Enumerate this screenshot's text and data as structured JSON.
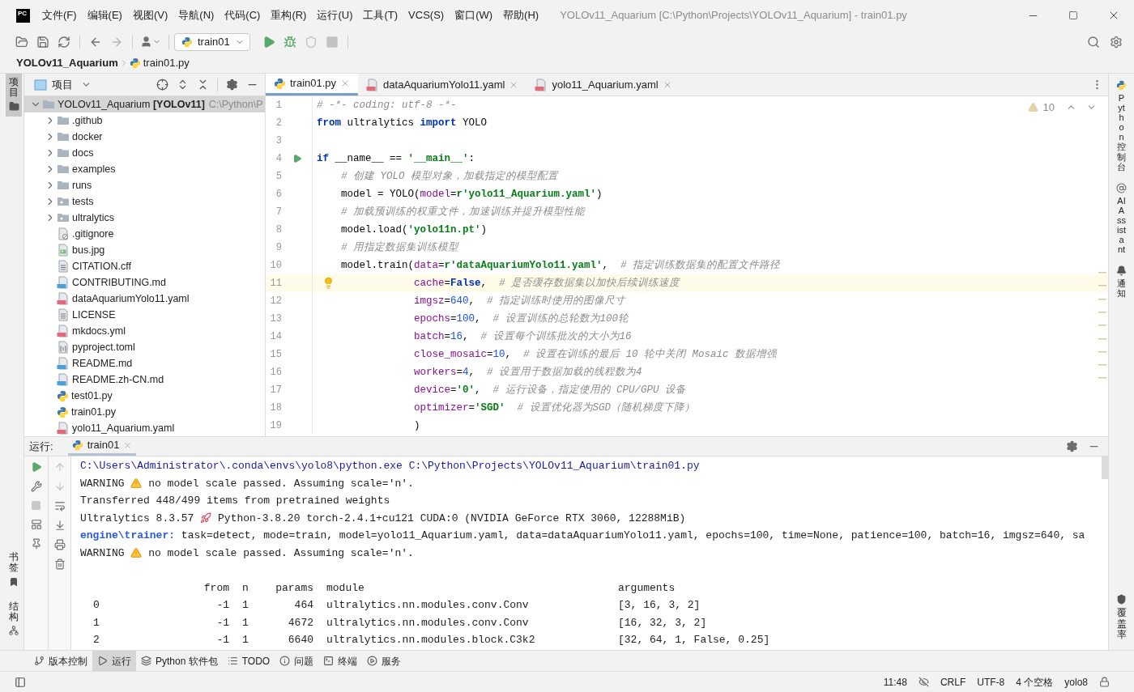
{
  "window": {
    "logo": "PC",
    "title": "YOLOv11_Aquarium [C:\\Python\\Projects\\YOLOv11_Aquarium] - train01.py"
  },
  "menu": [
    "文件(F)",
    "编辑(E)",
    "视图(V)",
    "导航(N)",
    "代码(C)",
    "重构(R)",
    "运行(U)",
    "工具(T)",
    "VCS(S)",
    "窗口(W)",
    "帮助(H)"
  ],
  "toolbar": {
    "run_config": "train01",
    "actions": [
      {
        "kind": "run",
        "disabled": false
      },
      {
        "kind": "debug",
        "disabled": false
      },
      {
        "kind": "coverage",
        "disabled": true
      },
      {
        "kind": "stop",
        "disabled": true
      }
    ]
  },
  "breadcrumb": {
    "project": "YOLOv11_Aquarium",
    "file": "train01.py"
  },
  "left_tool_tabs_top": [
    {
      "label": "项目",
      "selected": true
    }
  ],
  "left_tool_tabs_bottom": [
    {
      "label": "书签",
      "selected": false
    },
    {
      "label": "结构",
      "selected": false
    }
  ],
  "project_panel": {
    "title": "项目",
    "tree": [
      {
        "kind": "folder",
        "label": "YOLOv11_Aquarium **[YOLOv11]**",
        "path": "C:\\Python\\P",
        "expanded": true,
        "selected": true,
        "children": [
          {
            "kind": "folder",
            "label": ".github",
            "expanded": false,
            "selected": false
          },
          {
            "kind": "folder",
            "label": "docker",
            "expanded": false,
            "selected": false
          },
          {
            "kind": "folder",
            "label": "docs",
            "expanded": false,
            "selected": false
          },
          {
            "kind": "folder",
            "label": "examples",
            "expanded": false,
            "selected": false
          },
          {
            "kind": "folder",
            "label": "runs",
            "expanded": false,
            "selected": false
          },
          {
            "kind": "package",
            "label": "tests",
            "expanded": false,
            "selected": false
          },
          {
            "kind": "package",
            "label": "ultralytics",
            "expanded": false,
            "selected": false
          },
          {
            "kind": "ignore",
            "label": ".gitignore",
            "selected": false
          },
          {
            "kind": "image",
            "label": "bus.jpg",
            "selected": false
          },
          {
            "kind": "text",
            "label": "CITATION.cff",
            "selected": false
          },
          {
            "kind": "markdown",
            "label": "CONTRIBUTING.md",
            "selected": false
          },
          {
            "kind": "yaml",
            "label": "dataAquariumYolo11.yaml",
            "selected": false
          },
          {
            "kind": "text",
            "label": "LICENSE",
            "selected": false
          },
          {
            "kind": "yaml",
            "label": "mkdocs.yml",
            "selected": false
          },
          {
            "kind": "toml",
            "label": "pyproject.toml",
            "selected": false
          },
          {
            "kind": "markdown",
            "label": "README.md",
            "selected": false
          },
          {
            "kind": "markdown",
            "label": "README.zh-CN.md",
            "selected": false
          },
          {
            "kind": "python",
            "label": "test01.py",
            "selected": false
          },
          {
            "kind": "python",
            "label": "train01.py",
            "selected": false
          },
          {
            "kind": "yaml",
            "label": "yolo11_Aquarium.yaml",
            "selected": false
          }
        ]
      }
    ]
  },
  "editor": {
    "tabs": [
      {
        "label": "train01.py",
        "kind": "python",
        "selected": true
      },
      {
        "label": "dataAquariumYolo11.yaml",
        "kind": "yaml",
        "selected": false
      },
      {
        "label": "yolo11_Aquarium.yaml",
        "kind": "yaml",
        "selected": false
      }
    ],
    "warnings": "10",
    "lines": [
      {
        "number": "1",
        "current": false,
        "run_button": false,
        "bulb": false,
        "tokens": [
          {
            "kind": "comment",
            "text": "# -*- coding: utf-8 -*-"
          }
        ]
      },
      {
        "number": "2",
        "current": false,
        "run_button": false,
        "bulb": false,
        "tokens": [
          {
            "kind": "keyword",
            "text": "from"
          },
          {
            "kind": "plain",
            "text": " ultralytics "
          },
          {
            "kind": "keyword",
            "text": "import"
          },
          {
            "kind": "plain",
            "text": " YOLO"
          }
        ]
      },
      {
        "number": "3",
        "current": false,
        "run_button": false,
        "bulb": false
      },
      {
        "number": "4",
        "current": false,
        "run_button": true,
        "bulb": false,
        "tokens": [
          {
            "kind": "keyword",
            "text": "if"
          },
          {
            "kind": "plain",
            "text": " __name__ == "
          },
          {
            "kind": "string",
            "text": "'__main__'"
          },
          {
            "kind": "plain",
            "text": ":"
          }
        ]
      },
      {
        "number": "5",
        "current": false,
        "run_button": false,
        "bulb": false,
        "tokens": [
          {
            "kind": "comment",
            "text": "    # 创建 YOLO 模型对象，加载指定的模型配置"
          }
        ]
      },
      {
        "number": "6",
        "current": false,
        "run_button": false,
        "bulb": false,
        "tokens": [
          {
            "kind": "plain",
            "text": "    model = YOLO("
          },
          {
            "kind": "param",
            "text": "model"
          },
          {
            "kind": "plain",
            "text": "="
          },
          {
            "kind": "string",
            "text": "r'yolo11_Aquarium.yaml'"
          },
          {
            "kind": "plain",
            "text": ")"
          }
        ]
      },
      {
        "number": "7",
        "current": false,
        "run_button": false,
        "bulb": false,
        "tokens": [
          {
            "kind": "comment",
            "text": "    # 加载预训练的权重文件，加速训练并提升模型性能"
          }
        ]
      },
      {
        "number": "8",
        "current": false,
        "run_button": false,
        "bulb": false,
        "tokens": [
          {
            "kind": "plain",
            "text": "    model.load("
          },
          {
            "kind": "string",
            "text": "'yolo11n.pt'"
          },
          {
            "kind": "plain",
            "text": ")"
          }
        ]
      },
      {
        "number": "9",
        "current": false,
        "run_button": false,
        "bulb": false,
        "tokens": [
          {
            "kind": "comment",
            "text": "    # 用指定数据集训练模型"
          }
        ]
      },
      {
        "number": "10",
        "current": false,
        "run_button": false,
        "bulb": false,
        "tokens": [
          {
            "kind": "plain",
            "text": "    model.train("
          },
          {
            "kind": "param",
            "text": "data"
          },
          {
            "kind": "plain",
            "text": "="
          },
          {
            "kind": "string",
            "text": "r'dataAquariumYolo11.yaml'"
          },
          {
            "kind": "plain",
            "text": ",  "
          },
          {
            "kind": "comment",
            "text": "# 指定训练数据集的配置文件路径"
          }
        ]
      },
      {
        "number": "11",
        "current": true,
        "run_button": false,
        "bulb": true,
        "tokens": [
          {
            "kind": "param",
            "text": "                cache"
          },
          {
            "kind": "plain",
            "text": "="
          },
          {
            "kind": "keyword",
            "text": "False"
          },
          {
            "kind": "plain",
            "text": ",  "
          },
          {
            "kind": "comment",
            "text": "# 是否缓存数据集以加快后续训练速度"
          }
        ]
      },
      {
        "number": "12",
        "current": false,
        "run_button": false,
        "bulb": false,
        "tokens": [
          {
            "kind": "param",
            "text": "                imgsz"
          },
          {
            "kind": "plain",
            "text": "="
          },
          {
            "kind": "number",
            "text": "640"
          },
          {
            "kind": "plain",
            "text": ",  "
          },
          {
            "kind": "comment",
            "text": "# 指定训练时使用的图像尺寸"
          }
        ]
      },
      {
        "number": "13",
        "current": false,
        "run_button": false,
        "bulb": false,
        "tokens": [
          {
            "kind": "param",
            "text": "                epochs"
          },
          {
            "kind": "plain",
            "text": "="
          },
          {
            "kind": "number",
            "text": "100"
          },
          {
            "kind": "plain",
            "text": ",  "
          },
          {
            "kind": "comment",
            "text": "# 设置训练的总轮数为100轮"
          }
        ]
      },
      {
        "number": "14",
        "current": false,
        "run_button": false,
        "bulb": false,
        "tokens": [
          {
            "kind": "param",
            "text": "                batch"
          },
          {
            "kind": "plain",
            "text": "="
          },
          {
            "kind": "number",
            "text": "16"
          },
          {
            "kind": "plain",
            "text": ",  "
          },
          {
            "kind": "comment",
            "text": "# 设置每个训练批次的大小为16"
          }
        ]
      },
      {
        "number": "15",
        "current": false,
        "run_button": false,
        "bulb": false,
        "tokens": [
          {
            "kind": "param",
            "text": "                close_mosaic"
          },
          {
            "kind": "plain",
            "text": "="
          },
          {
            "kind": "number",
            "text": "10"
          },
          {
            "kind": "plain",
            "text": ",  "
          },
          {
            "kind": "comment",
            "text": "# 设置在训练的最后 10 轮中关闭 Mosaic 数据增强"
          }
        ]
      },
      {
        "number": "16",
        "current": false,
        "run_button": false,
        "bulb": false,
        "tokens": [
          {
            "kind": "param",
            "text": "                workers"
          },
          {
            "kind": "plain",
            "text": "="
          },
          {
            "kind": "number",
            "text": "4"
          },
          {
            "kind": "plain",
            "text": ",  "
          },
          {
            "kind": "comment",
            "text": "# 设置用于数据加载的线程数为4"
          }
        ]
      },
      {
        "number": "17",
        "current": false,
        "run_button": false,
        "bulb": false,
        "tokens": [
          {
            "kind": "param",
            "text": "                device"
          },
          {
            "kind": "plain",
            "text": "="
          },
          {
            "kind": "string",
            "text": "'0'"
          },
          {
            "kind": "plain",
            "text": ",  "
          },
          {
            "kind": "comment",
            "text": "# 运行设备，指定使用的 CPU/GPU 设备"
          }
        ]
      },
      {
        "number": "18",
        "current": false,
        "run_button": false,
        "bulb": false,
        "tokens": [
          {
            "kind": "param",
            "text": "                optimizer"
          },
          {
            "kind": "plain",
            "text": "="
          },
          {
            "kind": "string",
            "text": "'SGD'"
          },
          {
            "kind": "comment",
            "text": "  # 设置优化器为SGD（随机梯度下降）"
          }
        ]
      },
      {
        "number": "19",
        "current": false,
        "run_button": false,
        "bulb": false,
        "tokens": [
          {
            "kind": "plain",
            "text": "                )"
          }
        ]
      }
    ]
  },
  "run_panel": {
    "title": "运行:",
    "tabs": [
      {
        "label": "train01",
        "selected": true
      }
    ],
    "console": [
      [
        {
          "kind": "command",
          "text": "C:\\Users\\Administrator\\.conda\\envs\\yolo8\\python.exe C:\\Python\\Projects\\YOLOv11_Aquarium\\train01.py"
        }
      ],
      [
        {
          "kind": "text",
          "text": "WARNING"
        },
        {
          "kind": "warning"
        },
        {
          "kind": "text",
          "text": "no model scale passed. Assuming scale='n'."
        }
      ],
      [
        {
          "kind": "text",
          "text": "Transferred 448/499 items from pretrained weights"
        }
      ],
      [
        {
          "kind": "text",
          "text": "Ultralytics 8.3.57"
        },
        {
          "kind": "rocket"
        },
        {
          "kind": "text",
          "text": "Python-3.8.20 torch-2.4.1+cu121 CUDA:0 (NVIDIA GeForce RTX 3060, 12288MiB)"
        }
      ],
      [
        {
          "kind": "label",
          "text": "engine\\trainer:"
        },
        {
          "kind": "text",
          "text": "task=detect, mode=train, model=yolo11_Aquarium.yaml, data=dataAquariumYolo11.yaml, epochs=100, time=None, patience=100, batch=16, imgsz=640, sa"
        }
      ],
      [
        {
          "kind": "text",
          "text": "WARNING"
        },
        {
          "kind": "warning"
        },
        {
          "kind": "text",
          "text": "no model scale passed. Assuming scale='n'."
        }
      ]
    ],
    "table": {
      "columns": [
        "from",
        "n",
        "params",
        "module",
        "arguments"
      ],
      "rows": [
        {
          "index": "0",
          "from": "-1",
          "n": "1",
          "params": "464",
          "module": "ultralytics.nn.modules.conv.Conv",
          "arguments": "[3, 16, 3, 2]"
        },
        {
          "index": "1",
          "from": "-1",
          "n": "1",
          "params": "4672",
          "module": "ultralytics.nn.modules.conv.Conv",
          "arguments": "[16, 32, 3, 2]"
        },
        {
          "index": "2",
          "from": "-1",
          "n": "1",
          "params": "6640",
          "module": "ultralytics.nn.modules.block.C3k2",
          "arguments": "[32, 64, 1, False, 0.25]"
        }
      ]
    }
  },
  "right_tool_tabs_top": [
    {
      "label": "Python 控制台"
    },
    {
      "label": "AI Assistant"
    },
    {
      "label": "通知"
    }
  ],
  "right_tool_tabs_bottom": [
    {
      "label": "覆盖率"
    }
  ],
  "bottom_tabs": [
    {
      "label": "版本控制",
      "selected": false
    },
    {
      "label": "运行",
      "selected": true
    },
    {
      "label": "Python 软件包",
      "selected": false
    },
    {
      "label": "TODO",
      "selected": false
    },
    {
      "label": "问题",
      "selected": false
    },
    {
      "label": "终端",
      "selected": false
    },
    {
      "label": "服务",
      "selected": false
    }
  ],
  "status_bar": [
    "11:48",
    "CRLF",
    "UTF-8",
    "4 个空格",
    "yolo8"
  ]
}
